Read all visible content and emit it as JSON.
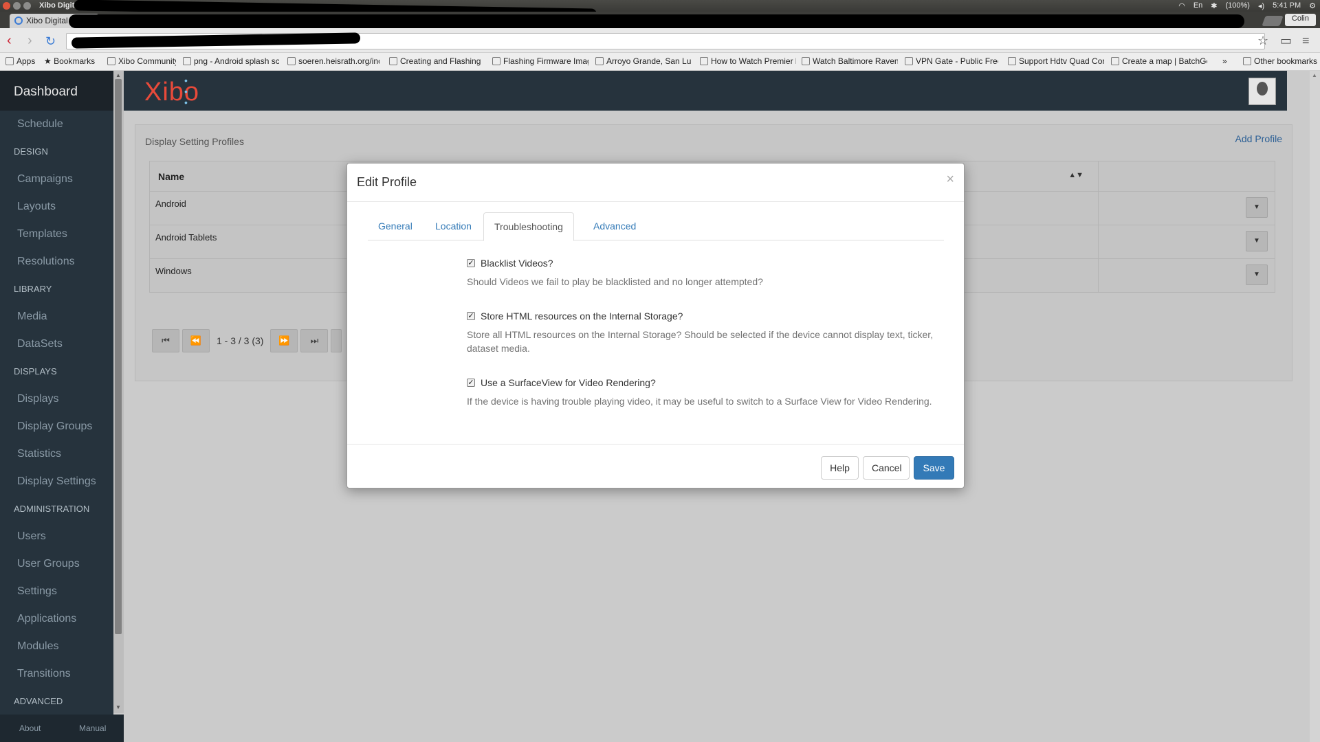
{
  "os": {
    "window_title": "Xibo Digital Signage - Google Chrome",
    "battery": "(100%)",
    "clock": "5:41 PM",
    "keyboard": "En"
  },
  "browser": {
    "active_tab_title": "Xibo Digital",
    "user": "Colin",
    "address_value": "",
    "bookmarks": [
      "Apps",
      "Bookmarks",
      "Xibo Community",
      "png - Android splash scr",
      "soeren.heisrath.org/ind",
      "Creating and Flashing a",
      "Flashing Firmware Imag",
      "Arroyo Grande, San Luis",
      "How to Watch Premier l",
      "Watch Baltimore Raven",
      "VPN Gate - Public Free",
      "Support Hdtv Quad Cor",
      "Create a map | BatchGe",
      "Other bookmarks"
    ]
  },
  "sidebar": {
    "dashboard": "Dashboard",
    "schedule": "Schedule",
    "design": "DESIGN",
    "campaigns": "Campaigns",
    "layouts": "Layouts",
    "templates": "Templates",
    "resolutions": "Resolutions",
    "library": "LIBRARY",
    "media": "Media",
    "datasets": "DataSets",
    "displays_header": "DISPLAYS",
    "displays": "Displays",
    "display_groups": "Display Groups",
    "statistics": "Statistics",
    "display_settings": "Display Settings",
    "administration": "ADMINISTRATION",
    "users": "Users",
    "user_groups": "User Groups",
    "settings": "Settings",
    "applications": "Applications",
    "modules": "Modules",
    "transitions": "Transitions",
    "advanced": "ADVANCED",
    "about": "About",
    "manual": "Manual"
  },
  "header": {
    "logo": "Xibo"
  },
  "content": {
    "title": "Display Setting Profiles",
    "add_profile": "Add Profile",
    "table": {
      "header_name": "Name",
      "rows": [
        "Android",
        "Android Tablets",
        "Windows"
      ]
    },
    "pager_info": "1 - 3 / 3 (3)"
  },
  "modal": {
    "title": "Edit Profile",
    "tabs": [
      "General",
      "Location",
      "Troubleshooting",
      "Advanced"
    ],
    "active_tab": "Troubleshooting",
    "options": [
      {
        "label": "Blacklist Videos?",
        "help": "Should Videos we fail to play be blacklisted and no longer attempted?",
        "checked": true
      },
      {
        "label": "Store HTML resources on the Internal Storage?",
        "help": "Store all HTML resources on the Internal Storage? Should be selected if the device cannot display text, ticker, dataset media.",
        "checked": true
      },
      {
        "label": "Use a SurfaceView for Video Rendering?",
        "help": "If the device is having trouble playing video, it may be useful to switch to a Surface View for Video Rendering.",
        "checked": true
      }
    ],
    "buttons": {
      "help": "Help",
      "cancel": "Cancel",
      "save": "Save"
    }
  },
  "colors": {
    "sidebar_bg": "#26333d",
    "primary": "#337ab7",
    "logo": "#e84a3a"
  }
}
